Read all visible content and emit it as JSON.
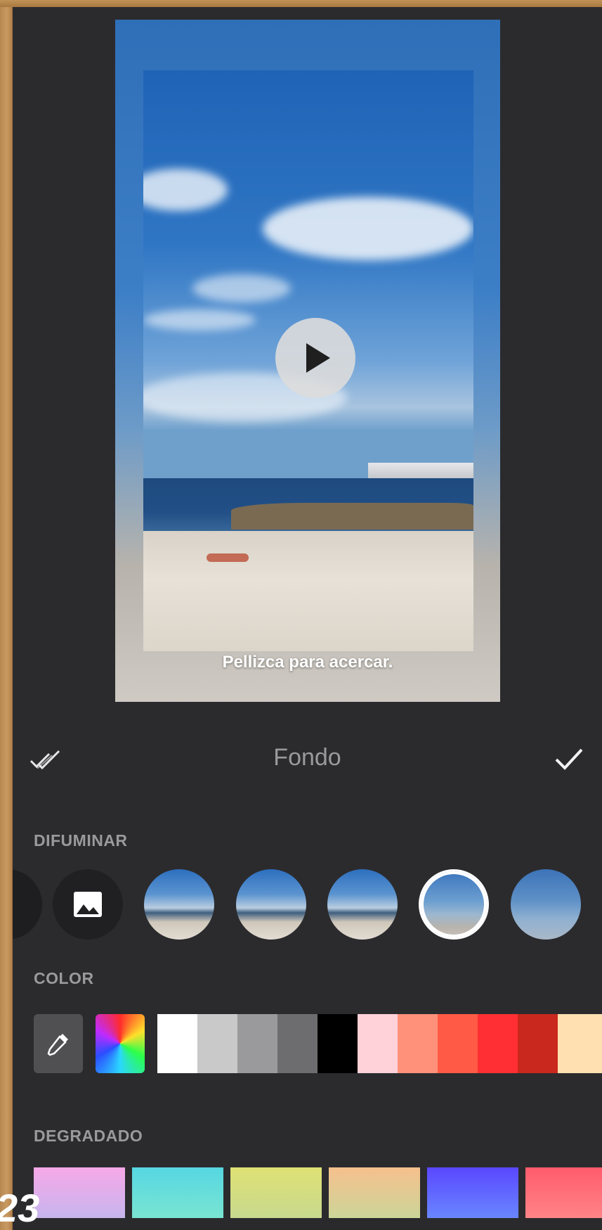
{
  "preview": {
    "hint_text": "Pellizca para acercar."
  },
  "toolbar": {
    "title": "Fondo"
  },
  "sections": {
    "blur_label": "DIFUMINAR",
    "color_label": "COLOR",
    "gradient_label": "DEGRADADO"
  },
  "colors": {
    "swatches": [
      "#ffffff",
      "#c9c9c9",
      "#9a9a9c",
      "#6d6d6f",
      "#000000",
      "#ffd1d9",
      "#ff907a",
      "#ff5a45",
      "#ff2f33",
      "#c8281d",
      "#ffe0b0"
    ]
  },
  "gradients": [
    [
      "#f7a8e8",
      "#c0b7ee"
    ],
    [
      "#56d7e2",
      "#7ee6d0"
    ],
    [
      "#dfe174",
      "#c4d892"
    ],
    [
      "#f6c08d",
      "#c6d89a"
    ],
    [
      "#5a47ff",
      "#6a8fff"
    ],
    [
      "#ff5b6c",
      "#ff8a8a"
    ]
  ],
  "corner_text": "23"
}
